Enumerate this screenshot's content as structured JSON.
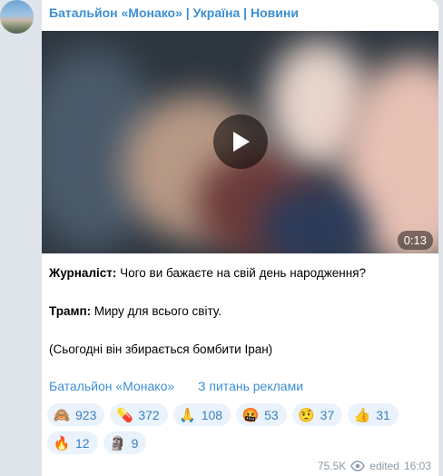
{
  "channel": {
    "name": "Батальйон «Монако» | Україна | Новини"
  },
  "video": {
    "duration": "0:13"
  },
  "message": {
    "p1_label": "Журналіст:",
    "p1_text": "Чого ви бажаєте на свій день народження?",
    "p2_label": "Трамп:",
    "p2_text": "Миру для всього світу.",
    "p3_text": "(Сьогодні він збирається бомбити Іран)"
  },
  "links": {
    "channel_link": "Батальйон «Монако»",
    "ads_link": "З питань реклами"
  },
  "reactions": [
    {
      "icon": "see-no-evil-monkey-icon",
      "emoji": "🙈",
      "count": "923"
    },
    {
      "icon": "pill-icon",
      "emoji": "💊",
      "count": "372"
    },
    {
      "icon": "folded-hands-icon",
      "emoji": "🙏",
      "count": "108"
    },
    {
      "icon": "cursing-face-icon",
      "emoji": "🤬",
      "count": "53"
    },
    {
      "icon": "unamused-face-icon",
      "emoji": "🤨",
      "count": "37"
    },
    {
      "icon": "thumbs-up-icon",
      "emoji": "👍",
      "count": "31"
    },
    {
      "icon": "fire-icon",
      "emoji": "🔥",
      "count": "12"
    },
    {
      "icon": "moai-icon",
      "emoji": "🗿",
      "count": "9"
    }
  ],
  "meta": {
    "views": "75.5K",
    "edited": "edited",
    "time": "16:03"
  },
  "colors": {
    "accent": "#3c8fd2",
    "reaction_bg": "#eaf3fb",
    "background": "#dfe5ea"
  }
}
